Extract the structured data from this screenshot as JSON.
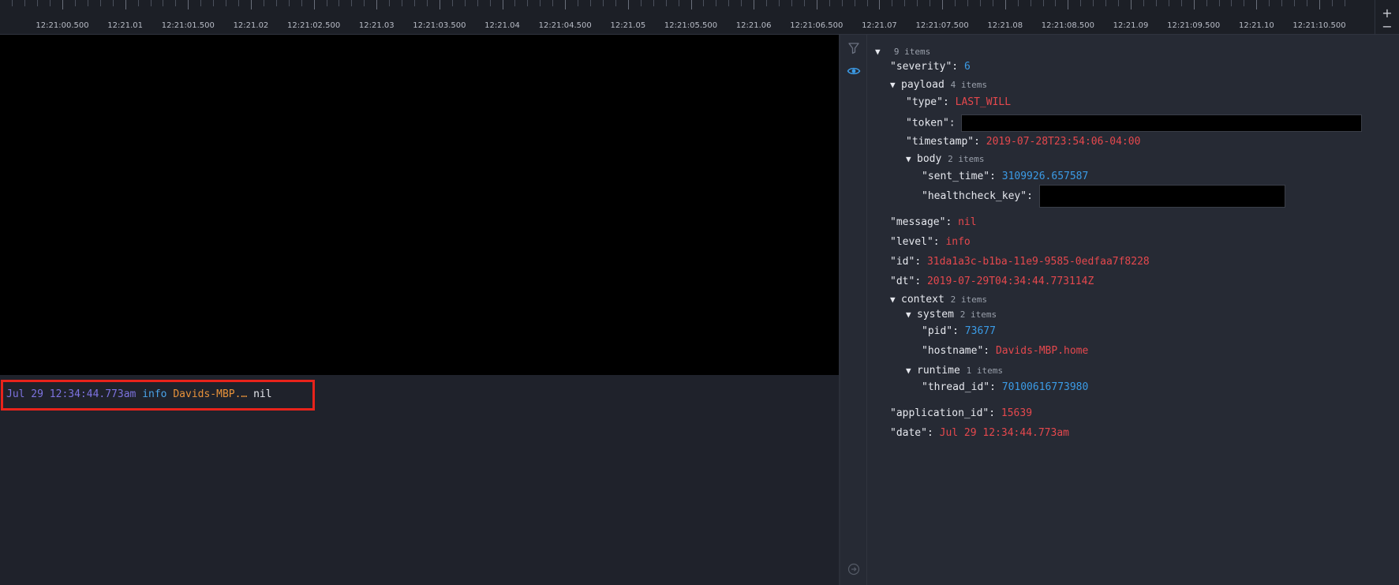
{
  "timeline": {
    "ticks": [
      "12:21:00.500",
      "12:21.01",
      "12:21:01.500",
      "12:21.02",
      "12:21:02.500",
      "12:21.03",
      "12:21:03.500",
      "12:21.04",
      "12:21:04.500",
      "12:21.05",
      "12:21:05.500",
      "12:21.06",
      "12:21:06.500",
      "12:21.07",
      "12:21:07.500",
      "12:21.08",
      "12:21:08.500",
      "12:21.09",
      "12:21:09.500",
      "12:21.10",
      "12:21:10.500"
    ],
    "zoom_in": "+",
    "zoom_out": "−"
  },
  "log": {
    "timestamp": "Jul 29 12:34:44.773am",
    "level": "info",
    "host": "Davids-MBP.…",
    "message": "nil",
    "highlight_color": "#e8231b"
  },
  "tools": {
    "filter_icon": "filter-icon",
    "view_icon": "eye-icon",
    "collapse_icon": "arrow-right-circle-icon"
  },
  "tree": {
    "root_count": "9 items",
    "severity_key": "\"severity\"",
    "severity_val": "6",
    "payload_key": "payload",
    "payload_count": "4 items",
    "type_key": "\"type\"",
    "type_val": "LAST_WILL",
    "token_key": "\"token\"",
    "timestamp_key": "\"timestamp\"",
    "timestamp_val": "2019-07-28T23:54:06-04:00",
    "body_key": "body",
    "body_count": "2 items",
    "sent_time_key": "\"sent_time\"",
    "sent_time_val": "3109926.657587",
    "healthcheck_key": "\"healthcheck_key\"",
    "message_key": "\"message\"",
    "message_val": "nil",
    "level_key": "\"level\"",
    "level_val": "info",
    "id_key": "\"id\"",
    "id_val": "31da1a3c-b1ba-11e9-9585-0edfaa7f8228",
    "dt_key": "\"dt\"",
    "dt_val": "2019-07-29T04:34:44.773114Z",
    "context_key": "context",
    "context_count": "2 items",
    "system_key": "system",
    "system_count": "2 items",
    "pid_key": "\"pid\"",
    "pid_val": "73677",
    "hostname_key": "\"hostname\"",
    "hostname_val": "Davids-MBP.home",
    "runtime_key": "runtime",
    "runtime_count": "1 items",
    "thread_id_key": "\"thread_id\"",
    "thread_id_val": "70100616773980",
    "application_id_key": "\"application_id\"",
    "application_id_val": "15639",
    "date_key": "\"date\"",
    "date_val": "Jul 29 12:34:44.773am"
  },
  "colors": {
    "string": "#e5484d",
    "number": "#3b9be6",
    "accent": "#3b9be6"
  }
}
